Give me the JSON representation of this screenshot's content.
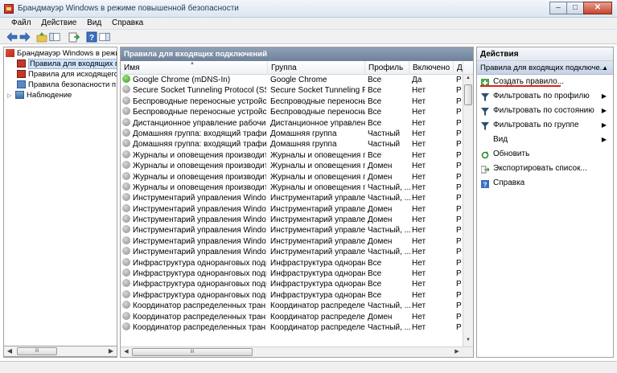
{
  "window": {
    "title": "Брандмауэр Windows в режиме повышенной безопасности",
    "minimize": "–",
    "maximize": "□",
    "close": "✕"
  },
  "menu": [
    "Файл",
    "Действие",
    "Вид",
    "Справка"
  ],
  "tree": {
    "items": [
      {
        "label": "Брандмауэр Windows в режим",
        "expander": "",
        "selected": false
      },
      {
        "label": "Правила для входящих по",
        "expander": "",
        "selected": true
      },
      {
        "label": "Правила для исходящего",
        "expander": "",
        "selected": false
      },
      {
        "label": "Правила безопасности п",
        "expander": "",
        "selected": false
      },
      {
        "label": "Наблюдение",
        "expander": "▷",
        "selected": false
      }
    ],
    "scroll_left": "◀",
    "scroll_right": "▶",
    "thumb_grip": "III"
  },
  "center": {
    "title": "Правила для входящих подключений",
    "columns": {
      "name": "Имя",
      "group": "Группа",
      "profile": "Профиль",
      "enabled": "Включено",
      "extra": "Д"
    },
    "rows": [
      {
        "name": "Google Chrome (mDNS-In)",
        "group": "Google Chrome",
        "profile": "Все",
        "enabled": "Да",
        "extra": "Р",
        "state": "on"
      },
      {
        "name": "Secure Socket Tunneling Protocol (SSTP-...",
        "group": "Secure Socket Tunneling Pr...",
        "profile": "Все",
        "enabled": "Нет",
        "extra": "Р",
        "state": "off"
      },
      {
        "name": "Беспроводные переносные устройства...",
        "group": "Беспроводные переносны...",
        "profile": "Все",
        "enabled": "Нет",
        "extra": "Р",
        "state": "off"
      },
      {
        "name": "Беспроводные переносные устройства...",
        "group": "Беспроводные переносны...",
        "profile": "Все",
        "enabled": "Нет",
        "extra": "Р",
        "state": "off"
      },
      {
        "name": "Дистанционное управление рабочим с...",
        "group": "Дистанционное управлен...",
        "profile": "Все",
        "enabled": "Нет",
        "extra": "Р",
        "state": "off"
      },
      {
        "name": "Домашняя группа: входящий трафик",
        "group": "Домашняя группа",
        "profile": "Частный",
        "enabled": "Нет",
        "extra": "Р",
        "state": "off"
      },
      {
        "name": "Домашняя группа: входящий трафик (...",
        "group": "Домашняя группа",
        "profile": "Частный",
        "enabled": "Нет",
        "extra": "Р",
        "state": "off"
      },
      {
        "name": "Журналы и оповещения производител...",
        "group": "Журналы и оповещения п...",
        "profile": "Все",
        "enabled": "Нет",
        "extra": "Р",
        "state": "off"
      },
      {
        "name": "Журналы и оповещения производител...",
        "group": "Журналы и оповещения п...",
        "profile": "Домен",
        "enabled": "Нет",
        "extra": "Р",
        "state": "off"
      },
      {
        "name": "Журналы и оповещения производител...",
        "group": "Журналы и оповещения п...",
        "profile": "Домен",
        "enabled": "Нет",
        "extra": "Р",
        "state": "off"
      },
      {
        "name": "Журналы и оповещения производител...",
        "group": "Журналы и оповещения п...",
        "profile": "Частный, ...",
        "enabled": "Нет",
        "extra": "Р",
        "state": "off"
      },
      {
        "name": "Инструментарий управления Windows ...",
        "group": "Инструментарий управлен...",
        "profile": "Частный, ...",
        "enabled": "Нет",
        "extra": "Р",
        "state": "off"
      },
      {
        "name": "Инструментарий управления Windows ...",
        "group": "Инструментарий управлен...",
        "profile": "Домен",
        "enabled": "Нет",
        "extra": "Р",
        "state": "off"
      },
      {
        "name": "Инструментарий управления Windows ...",
        "group": "Инструментарий управлен...",
        "profile": "Домен",
        "enabled": "Нет",
        "extra": "Р",
        "state": "off"
      },
      {
        "name": "Инструментарий управления Windows ...",
        "group": "Инструментарий управлен...",
        "profile": "Частный, ...",
        "enabled": "Нет",
        "extra": "Р",
        "state": "off"
      },
      {
        "name": "Инструментарий управления Windows ...",
        "group": "Инструментарий управлен...",
        "profile": "Домен",
        "enabled": "Нет",
        "extra": "Р",
        "state": "off"
      },
      {
        "name": "Инструментарий управления Windows ...",
        "group": "Инструментарий управлен...",
        "profile": "Частный, ...",
        "enabled": "Нет",
        "extra": "Р",
        "state": "off"
      },
      {
        "name": "Инфраструктура одноранговых подкл...",
        "group": "Инфраструктура одноранг...",
        "profile": "Все",
        "enabled": "Нет",
        "extra": "Р",
        "state": "off"
      },
      {
        "name": "Инфраструктура одноранговых подкл...",
        "group": "Инфраструктура одноранг...",
        "profile": "Все",
        "enabled": "Нет",
        "extra": "Р",
        "state": "off"
      },
      {
        "name": "Инфраструктура одноранговых подкл...",
        "group": "Инфраструктура одноранг...",
        "profile": "Все",
        "enabled": "Нет",
        "extra": "Р",
        "state": "off"
      },
      {
        "name": "Инфраструктура одноранговых подкл...",
        "group": "Инфраструктура одноранг...",
        "profile": "Все",
        "enabled": "Нет",
        "extra": "Р",
        "state": "off"
      },
      {
        "name": "Координатор распределенных транзак...",
        "group": "Координатор распределен...",
        "profile": "Частный, ...",
        "enabled": "Нет",
        "extra": "Р",
        "state": "off"
      },
      {
        "name": "Координатор распределенных транзак...",
        "group": "Координатор распределен...",
        "profile": "Домен",
        "enabled": "Нет",
        "extra": "Р",
        "state": "off"
      },
      {
        "name": "Координатор распределенных транзак...",
        "group": "Координатор распределен...",
        "profile": "Частный, ...",
        "enabled": "Нет",
        "extra": "Р",
        "state": "off"
      }
    ],
    "hscroll": {
      "left": "◀",
      "right": "▶",
      "grip": "III"
    },
    "vscroll": {
      "up": "▲",
      "down": "▼"
    }
  },
  "actions": {
    "title": "Действия",
    "section": "Правила для входящих подключе...",
    "section_arrow": "▲",
    "items": [
      {
        "label": "Создать правило...",
        "icon": "new-rule-icon",
        "submenu": ""
      },
      {
        "label": "Фильтровать по профилю",
        "icon": "filter-icon",
        "submenu": "▶"
      },
      {
        "label": "Фильтровать по состоянию",
        "icon": "filter-icon",
        "submenu": "▶"
      },
      {
        "label": "Фильтровать по группе",
        "icon": "filter-icon",
        "submenu": "▶"
      },
      {
        "label": "Вид",
        "icon": "",
        "submenu": "▶"
      },
      {
        "label": "Обновить",
        "icon": "refresh-icon",
        "submenu": ""
      },
      {
        "label": "Экспортировать список...",
        "icon": "export-icon",
        "submenu": ""
      },
      {
        "label": "Справка",
        "icon": "help-icon",
        "submenu": ""
      }
    ]
  },
  "colors": {
    "selection": "#cfe3f7",
    "panel_header": "#7d90a8",
    "highlight_underline": "#e0201a",
    "enabled_icon": "#2e9a1c"
  }
}
